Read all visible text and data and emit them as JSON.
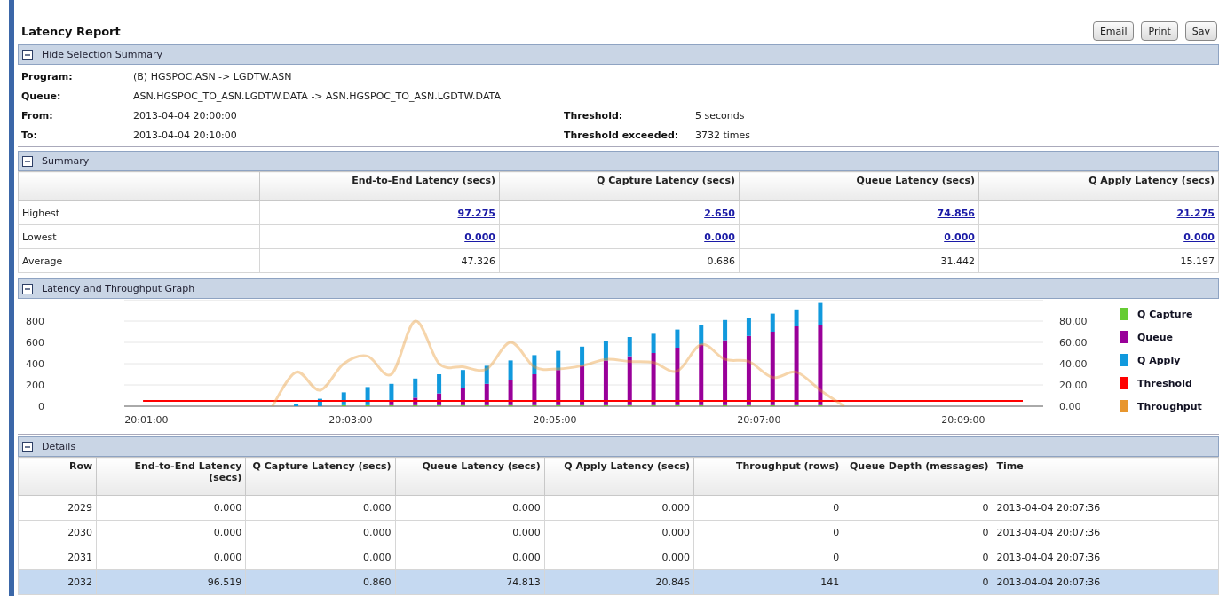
{
  "title": "Latency Report",
  "buttons": [
    "Email",
    "Print",
    "Sav"
  ],
  "selection_summary": {
    "header": "Hide Selection Summary",
    "expanded": true,
    "rows": [
      {
        "label": "Program:",
        "value": "(B) HGSPOC.ASN -> LGDTW.ASN"
      },
      {
        "label": "Queue:",
        "value": "ASN.HGSPOC_TO_ASN.LGDTW.DATA -> ASN.HGSPOC_TO_ASN.LGDTW.DATA"
      },
      {
        "label": "From:",
        "value": "2013-04-04 20:00:00",
        "side": {
          "label": "Threshold:",
          "value": "5 seconds"
        }
      },
      {
        "label": "To:",
        "value": "2013-04-04 20:10:00",
        "side": {
          "label": "Threshold exceeded:",
          "value": "3732 times"
        }
      }
    ]
  },
  "summary": {
    "header": "Summary",
    "expanded": true,
    "columns": [
      "End-to-End Latency (secs)",
      "Q Capture Latency (secs)",
      "Queue Latency (secs)",
      "Q Apply Latency (secs)"
    ],
    "rows": [
      {
        "label": "Highest",
        "kind": "link",
        "values": [
          "97.275",
          "2.650",
          "74.856",
          "21.275"
        ]
      },
      {
        "label": "Lowest",
        "kind": "link",
        "values": [
          "0.000",
          "0.000",
          "0.000",
          "0.000"
        ]
      },
      {
        "label": "Average",
        "kind": "plain",
        "values": [
          "47.326",
          "0.686",
          "31.442",
          "15.197"
        ]
      }
    ]
  },
  "graph": {
    "header": "Latency and Throughput Graph",
    "expanded": true,
    "chart_data": {
      "type": "bar",
      "stacked": true,
      "grid": true,
      "x": [
        72058,
        72134,
        72148,
        72162,
        72176,
        72190,
        72204,
        72218,
        72232,
        72246,
        72260,
        72274,
        72288,
        72302,
        72316,
        72330,
        72344,
        72358,
        72372,
        72386,
        72400,
        72414,
        72428,
        72442,
        72456,
        72470,
        72575
      ],
      "xlim": [
        72047,
        72587
      ],
      "xticks": [
        {
          "value": 72060,
          "label": "20:01:00"
        },
        {
          "value": 72180,
          "label": "20:03:00"
        },
        {
          "value": 72300,
          "label": "20:05:00"
        },
        {
          "value": 72420,
          "label": "20:07:00"
        },
        {
          "value": 72540,
          "label": "20:09:00"
        }
      ],
      "ylim": [
        0,
        100
      ],
      "y2lim": [
        0,
        1000
      ],
      "yticks": [
        {
          "value": 0,
          "label": "0.00"
        },
        {
          "value": 20,
          "label": "20.00"
        },
        {
          "value": 40,
          "label": "40.00"
        },
        {
          "value": 60,
          "label": "60.00"
        },
        {
          "value": 80,
          "label": "80.00"
        }
      ],
      "y2ticks": [
        0,
        200,
        400,
        600,
        800
      ],
      "series": [
        {
          "name": "Q Capture",
          "color": "#66cc33",
          "values": [
            null,
            null,
            0,
            0,
            1,
            1,
            1,
            1,
            1,
            1,
            1,
            1,
            1,
            1,
            1,
            1,
            1,
            1,
            1,
            1,
            1,
            1,
            1,
            1,
            1,
            null,
            null
          ]
        },
        {
          "name": "Queue",
          "color": "#990099",
          "values": [
            null,
            null,
            0,
            0,
            0,
            0,
            4,
            7,
            11,
            16,
            20,
            24,
            29,
            33,
            37,
            42,
            46,
            49,
            54,
            57,
            61,
            65,
            69,
            74,
            75,
            null,
            null
          ]
        },
        {
          "name": "Q Apply",
          "color": "#1199dd",
          "values": [
            null,
            null,
            2,
            7,
            12,
            17,
            16,
            18,
            18,
            17,
            17,
            18,
            18,
            18,
            18,
            18,
            18,
            18,
            17,
            18,
            19,
            17,
            17,
            16,
            21,
            null,
            null
          ]
        },
        {
          "name": "Threshold",
          "color": "#ff0000",
          "type": "line",
          "values": [
            5,
            5,
            5,
            5,
            5,
            5,
            5,
            5,
            5,
            5,
            5,
            5,
            5,
            5,
            5,
            5,
            5,
            5,
            5,
            5,
            5,
            5,
            5,
            5,
            5,
            5,
            5
          ]
        },
        {
          "name": "Throughput",
          "color": "#e8962e",
          "type": "line",
          "axis": "y2",
          "values": [
            null,
            0,
            320,
            150,
            400,
            470,
            300,
            800,
            400,
            370,
            350,
            600,
            370,
            350,
            380,
            440,
            420,
            410,
            330,
            580,
            440,
            420,
            270,
            320,
            150,
            0,
            null
          ]
        }
      ]
    }
  },
  "details": {
    "header": "Details",
    "expanded": true,
    "columns": [
      "Row",
      "End-to-End Latency (secs)",
      "Q Capture Latency (secs)",
      "Queue Latency (secs)",
      "Q Apply Latency (secs)",
      "Throughput (rows)",
      "Queue Depth (messages)",
      "Time"
    ],
    "rows": [
      {
        "selected": false,
        "cells": [
          "2029",
          "0.000",
          "0.000",
          "0.000",
          "0.000",
          "0",
          "0",
          "2013-04-04 20:07:36"
        ]
      },
      {
        "selected": false,
        "cells": [
          "2030",
          "0.000",
          "0.000",
          "0.000",
          "0.000",
          "0",
          "0",
          "2013-04-04 20:07:36"
        ]
      },
      {
        "selected": false,
        "cells": [
          "2031",
          "0.000",
          "0.000",
          "0.000",
          "0.000",
          "0",
          "0",
          "2013-04-04 20:07:36"
        ]
      },
      {
        "selected": true,
        "cells": [
          "2032",
          "96.519",
          "0.860",
          "74.813",
          "20.846",
          "141",
          "0",
          "2013-04-04 20:07:36"
        ]
      }
    ]
  }
}
